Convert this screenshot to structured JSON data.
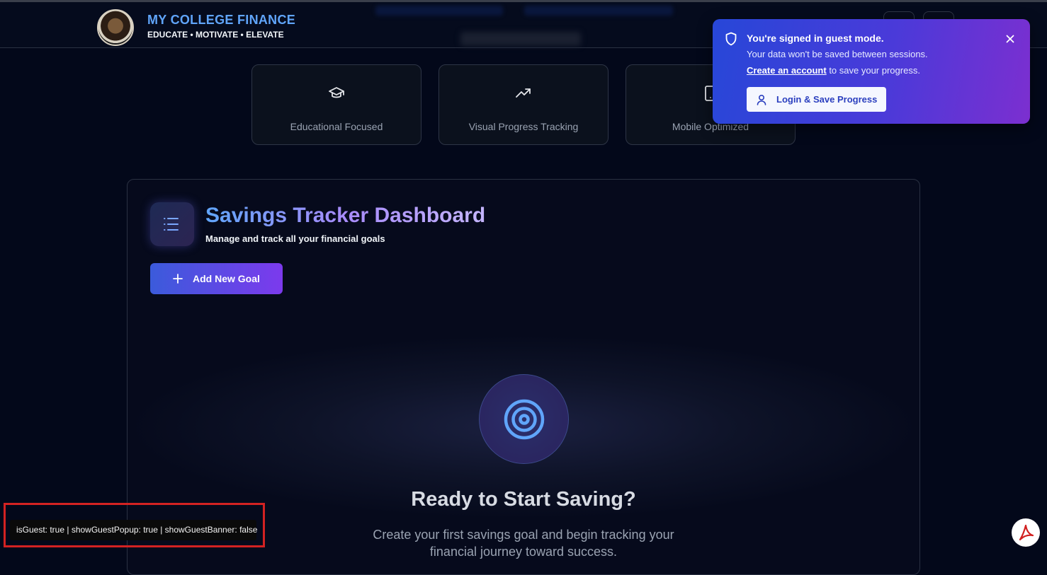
{
  "brand": {
    "title": "MY COLLEGE FINANCE",
    "tagline": "EDUCATE • MOTIVATE • ELEVATE"
  },
  "features": [
    {
      "label": "Educational Focused",
      "icon": "graduation-cap-icon"
    },
    {
      "label": "Visual Progress Tracking",
      "icon": "trending-up-icon"
    },
    {
      "label": "Mobile Optimized",
      "icon": "tablet-icon"
    }
  ],
  "dashboard": {
    "title": "Savings Tracker Dashboard",
    "subtitle": "Manage and track all your financial goals",
    "icon": "list-icon",
    "add_goal_label": "Add New Goal",
    "empty_icon": "target-icon",
    "empty_title": "Ready to Start Saving?",
    "empty_text": "Create your first savings goal and begin tracking your financial journey toward success."
  },
  "guest_popup": {
    "title": "You're signed in guest mode.",
    "line1": "Your data won't be saved between sessions.",
    "link_text": "Create an account",
    "line2_rest": " to save your progress.",
    "login_label": "Login & Save Progress",
    "icons": [
      "shield-icon",
      "close-icon",
      "user-icon"
    ]
  },
  "debug": {
    "text": "isGuest: true | showGuestPopup: true | showGuestBanner: false"
  },
  "colors": {
    "background": "#03081a",
    "accent_blue": "#60a5fa",
    "accent_purple": "#a78bfa",
    "popup_start": "#2747d8",
    "popup_end": "#7c2fd0",
    "debug_outline": "#d32222"
  }
}
